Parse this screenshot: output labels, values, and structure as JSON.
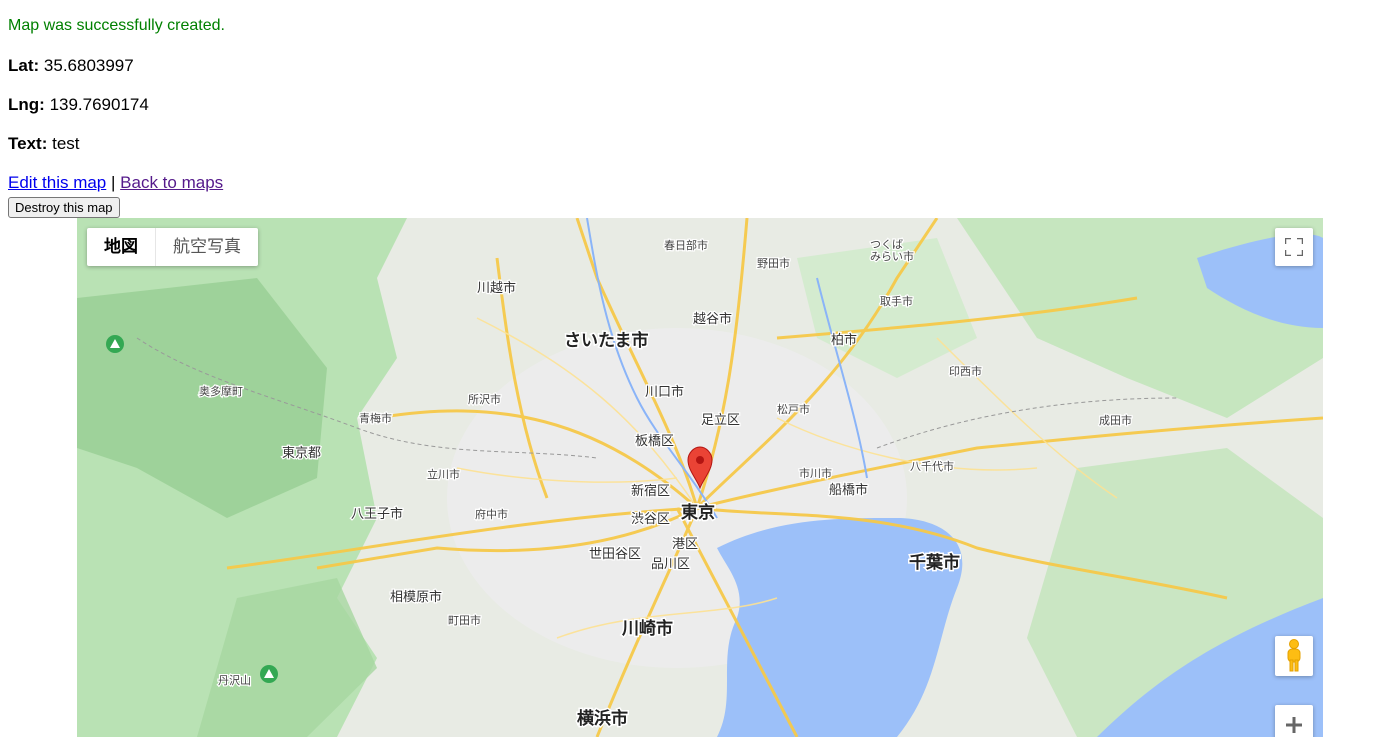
{
  "notice": "Map was successfully created.",
  "fields": {
    "lat_label": "Lat:",
    "lat_value": "35.6803997",
    "lng_label": "Lng:",
    "lng_value": "139.7690174",
    "text_label": "Text:",
    "text_value": "test"
  },
  "links": {
    "edit": "Edit this map",
    "separator": "|",
    "back": "Back to maps"
  },
  "destroy_button": "Destroy this map",
  "map": {
    "type_buttons": {
      "map": "地図",
      "satellite": "航空写真"
    },
    "labels": {
      "tokyo": "東京",
      "saitama": "さいたま市",
      "chiba": "千葉市",
      "kawasaki": "川崎市",
      "yokohama": "横浜市",
      "kawagoe": "川越市",
      "koshigaya": "越谷市",
      "kawaguchi": "川口市",
      "adachi": "足立区",
      "itabashi": "板橋区",
      "shinjuku": "新宿区",
      "shibuya": "渋谷区",
      "minato": "港区",
      "setagaya": "世田谷区",
      "shinagawa": "品川区",
      "funabashi": "船橋市",
      "kashiwa": "柏市",
      "hachioji": "八王子市",
      "sagamihara": "相模原市",
      "tokyo_to": "東京都",
      "okutama": "奥多摩町",
      "ichikawa": "市川市",
      "matsudo": "松戸市",
      "narita": "成田市",
      "yachiyo": "八千代市",
      "inzai": "印西市",
      "tanzawa": "丹沢山",
      "tachikawa": "立川市",
      "fuchu": "府中市",
      "machida": "町田市",
      "ome": "青梅市",
      "tokorozawa": "所沢市",
      "kasukabe": "春日部市",
      "noda": "野田市",
      "toride": "取手市",
      "tsukuba": "つくば\nみらい市"
    }
  }
}
